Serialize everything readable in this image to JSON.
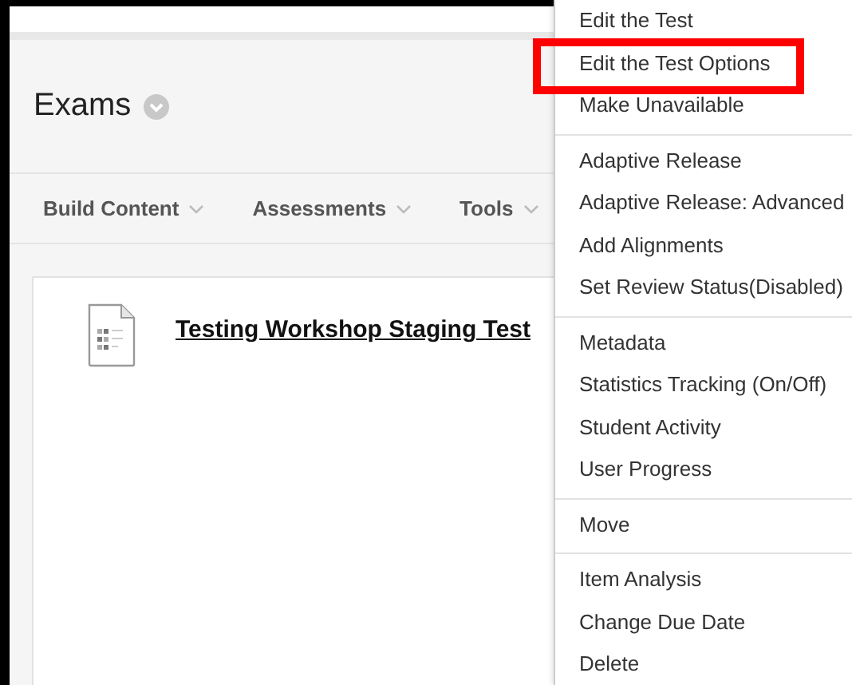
{
  "page": {
    "title": "Exams"
  },
  "toolbar": [
    {
      "label": "Build Content"
    },
    {
      "label": "Assessments"
    },
    {
      "label": "Tools"
    }
  ],
  "content": {
    "items": [
      {
        "title": "Testing Workshop Staging Test"
      }
    ]
  },
  "context_menu": {
    "sections": [
      {
        "items": [
          {
            "label": "Edit the Test",
            "highlighted": false
          },
          {
            "label": "Edit the Test Options",
            "highlighted": true
          },
          {
            "label": "Make Unavailable",
            "highlighted": false
          }
        ]
      },
      {
        "items": [
          {
            "label": "Adaptive Release",
            "highlighted": false
          },
          {
            "label": "Adaptive Release: Advanced",
            "highlighted": false
          },
          {
            "label": "Add Alignments",
            "highlighted": false
          },
          {
            "label": "Set Review Status(Disabled)",
            "highlighted": false
          }
        ]
      },
      {
        "items": [
          {
            "label": "Metadata",
            "highlighted": false
          },
          {
            "label": "Statistics Tracking (On/Off)",
            "highlighted": false
          },
          {
            "label": "Student Activity",
            "highlighted": false
          },
          {
            "label": "User Progress",
            "highlighted": false
          }
        ]
      },
      {
        "items": [
          {
            "label": "Move",
            "highlighted": false
          }
        ]
      },
      {
        "items": [
          {
            "label": "Item Analysis",
            "highlighted": false
          },
          {
            "label": "Change Due Date",
            "highlighted": false
          },
          {
            "label": "Delete",
            "highlighted": false
          }
        ]
      }
    ]
  }
}
